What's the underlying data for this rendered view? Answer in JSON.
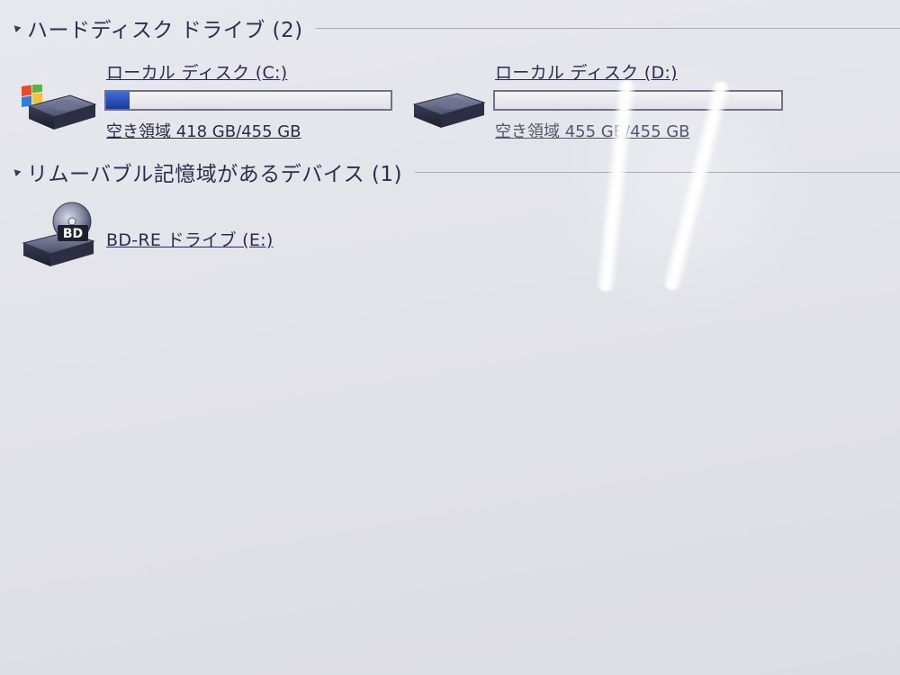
{
  "groups": {
    "hdd": {
      "title": "ハードディスク ドライブ (2)",
      "drives": [
        {
          "name": "ローカル ディスク (C:)",
          "free_text": "空き領域 418 GB/455 GB",
          "used_fraction": 0.081,
          "icon": "windows-drive-icon"
        },
        {
          "name": "ローカル ディスク (D:)",
          "free_text": "空き領域 455 GB/455 GB",
          "used_fraction": 0.0,
          "icon": "hard-drive-icon"
        }
      ]
    },
    "removable": {
      "title": "リムーバブル記憶域があるデバイス (1)",
      "drives": [
        {
          "name": "BD-RE ドライブ (E:)",
          "icon": "bd-drive-icon",
          "icon_label": "BD"
        }
      ]
    }
  },
  "colors": {
    "bar_fill": "#2448b8",
    "text": "#2a2b4a"
  }
}
